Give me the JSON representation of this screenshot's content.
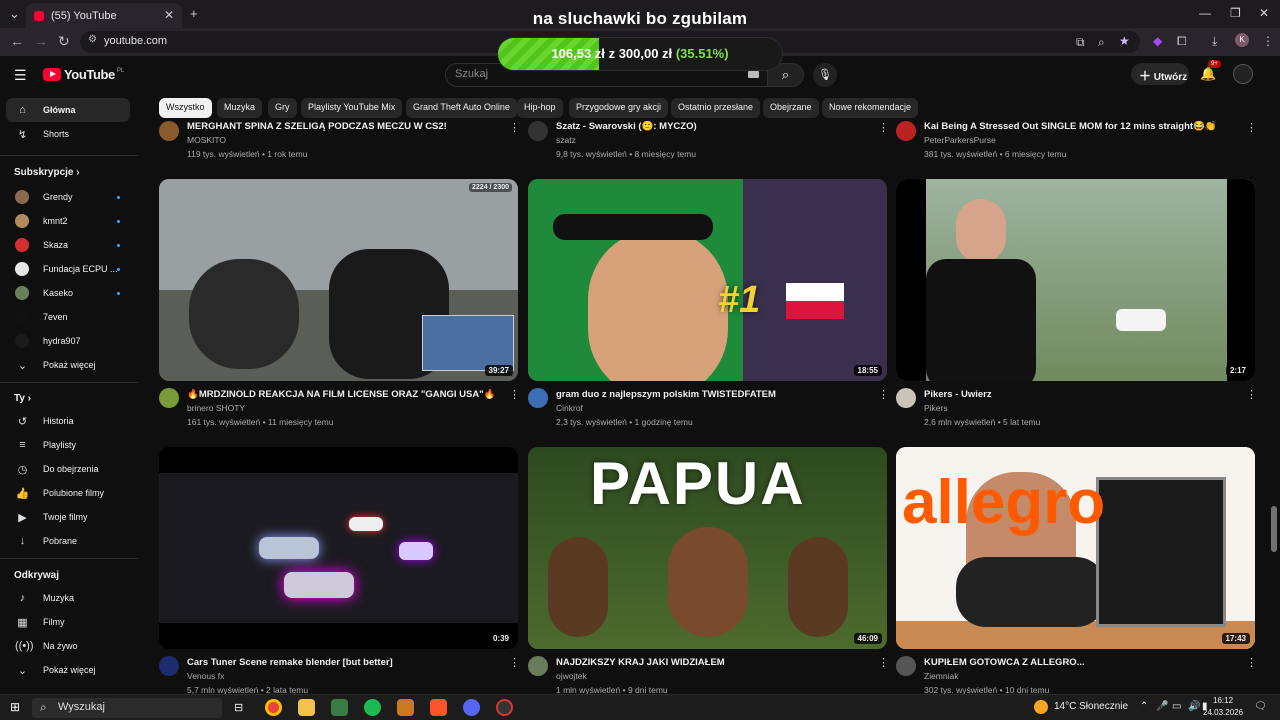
{
  "browser": {
    "tab_count_badge": "(55) YouTube",
    "overlay_title": "na sluchawki bo zgubilam",
    "url": "youtube.com",
    "new_tab": "+",
    "close": "✕"
  },
  "donation": {
    "current": "106,53 zł",
    "sep": "z",
    "goal": "300,00 zł",
    "percent_text": "(35.51%)",
    "progress_fraction": 0.3551
  },
  "header": {
    "logo": "YouTube",
    "country": "PL",
    "search_placeholder": "Szukaj",
    "create_label": "Utwórz",
    "notifications": "9+"
  },
  "chips": [
    "Wszystko",
    "Muzyka",
    "Gry",
    "Playlisty YouTube Mix",
    "Grand Theft Auto Online",
    "Hip-hop",
    "Przygodowe gry akcji",
    "Ostatnio przesłane",
    "Obejrzane",
    "Nowe rekomendacje"
  ],
  "sidebar": {
    "main": [
      {
        "label": "Główna",
        "icon": "home-icon"
      },
      {
        "label": "Shorts",
        "icon": "shorts-icon"
      }
    ],
    "subs_title": "Subskrypcje",
    "subs": [
      {
        "label": "Grendy",
        "color": "#8a6a4f"
      },
      {
        "label": "kmnt2",
        "color": "#b5895e"
      },
      {
        "label": "Skaza",
        "color": "#d32f2f"
      },
      {
        "label": "Fundacja ECPU ...",
        "color": "#e6e6e6"
      },
      {
        "label": "Kaseko",
        "color": "#6b7f5a"
      },
      {
        "label": "7even",
        "color": "#111111"
      },
      {
        "label": "hydra907",
        "color": "#1a1a1a"
      }
    ],
    "subs_more": "Pokaż więcej",
    "you_title": "Ty",
    "you": [
      {
        "label": "Historia",
        "icon": "history-icon"
      },
      {
        "label": "Playlisty",
        "icon": "playlists-icon"
      },
      {
        "label": "Do obejrzenia",
        "icon": "watch-later-icon"
      },
      {
        "label": "Polubione filmy",
        "icon": "liked-icon"
      },
      {
        "label": "Twoje filmy",
        "icon": "your-videos-icon"
      },
      {
        "label": "Pobrane",
        "icon": "download-icon"
      }
    ],
    "explore_title": "Odkrywaj",
    "explore": [
      {
        "label": "Muzyka",
        "icon": "music-icon"
      },
      {
        "label": "Filmy",
        "icon": "movies-icon"
      },
      {
        "label": "Na żywo",
        "icon": "live-icon"
      }
    ],
    "explore_more": "Pokaż więcej"
  },
  "top_row": [
    {
      "title": "MERGHANT SPINA Z SZELIGĄ PODCZAS MECZU W CS2!",
      "channel": "MOSKITO",
      "stats": "119 tys. wyświetleń • 1 rok temu"
    },
    {
      "title": "Szatz - Swarovski (🙂: MYCZO)",
      "channel": "szatz",
      "stats": "9,8 tys. wyświetleń • 8 miesięcy temu"
    },
    {
      "title": "Kai Being A Stressed Out SINGLE MOM for 12 mins straight😂👏",
      "channel": "PeterParkersPurse",
      "stats": "381 tys. wyświetleń • 6 miesięcy temu"
    }
  ],
  "videos": [
    {
      "title": "🔥MRDZINOLD REAKCJA NA FILM LICENSE ORAZ \"GANGI USA\"🔥",
      "channel": "brinero SHOTY",
      "stats": "161 tys. wyświetleń • 11 miesięcy temu",
      "duration": "39:27",
      "badge": "2224 / 2300",
      "bg": "#5b5d59",
      "av": "#7a9b3a"
    },
    {
      "title": "gram duo z najlepszym polskim TWISTEDFATEM",
      "channel": "Cinkrof",
      "stats": "2,3 tys. wyświetleń • 1 godzinę temu",
      "duration": "18:55",
      "overlay": "#1",
      "bg": "#2b6b2d",
      "av": "#3c6fb5"
    },
    {
      "title": "Pikers - Uwierz",
      "channel": "Pikers",
      "stats": "2,6 mln wyświetleń • 5 lat temu",
      "duration": "2:17",
      "bg": "#8a9a86",
      "av": "#c9c3b8"
    },
    {
      "title": "Cars Tuner Scene remake blender [but better]",
      "channel": "Venous fx",
      "stats": "5,7 mln wyświetleń • 2 lata temu",
      "duration": "0:39",
      "bg": "#1b1a20",
      "av": "#1e2b6e"
    },
    {
      "title": "NAJDZIKSZY KRAJ JAKI WIDZIAŁEM",
      "channel": "ojwojtek",
      "stats": "1 mln wyświetleń • 9 dni temu",
      "duration": "46:09",
      "overlay": "PAPUA",
      "bg": "#3f5a2a",
      "av": "#6a7d5b"
    },
    {
      "title": "KUPIŁEM GOTOWCA Z ALLEGRO...",
      "channel": "Ziemniak",
      "stats": "302 tys. wyświetleń • 10 dni temu",
      "duration": "17:43",
      "overlay": "allegro",
      "bg": "#ffffff",
      "av": "#555555"
    }
  ],
  "taskbar": {
    "search": "Wyszukaj",
    "weather": "14°C  Słonecznie",
    "time": "16:12",
    "date": "24.03.2026"
  }
}
